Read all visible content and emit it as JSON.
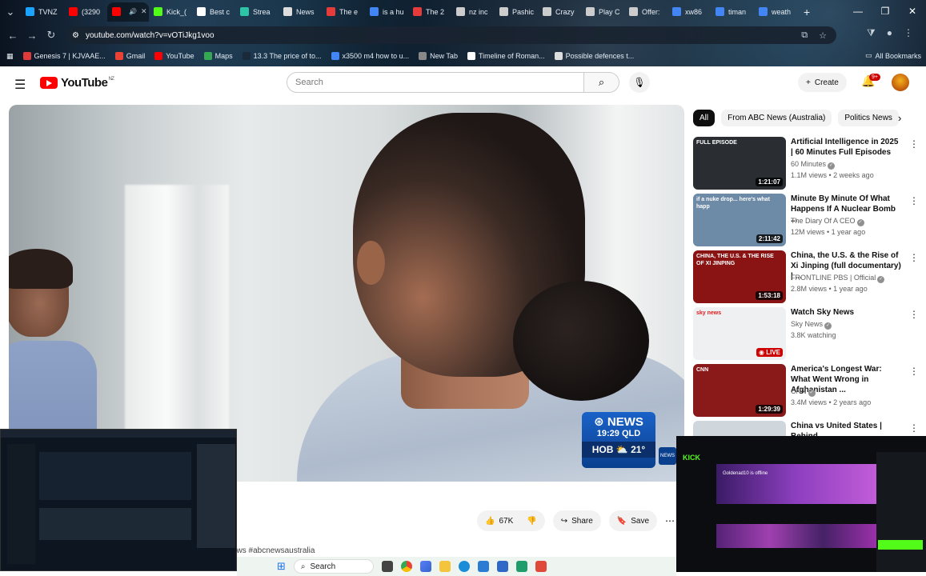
{
  "browser": {
    "tabs": [
      {
        "label": "TVNZ",
        "color": "#1aa3ff"
      },
      {
        "label": "(3290",
        "color": "#ff0000"
      },
      {
        "label": "",
        "color": "#ff0000",
        "active": true
      },
      {
        "label": "Kick_(",
        "color": "#53fc18"
      },
      {
        "label": "Best c",
        "color": "#ffffff"
      },
      {
        "label": "Strea",
        "color": "#2ec4a6"
      },
      {
        "label": "News",
        "color": "#dddddd"
      },
      {
        "label": "The e",
        "color": "#e63b3b"
      },
      {
        "label": "is a hu",
        "color": "#4285f4"
      },
      {
        "label": "The 2",
        "color": "#e63b3b"
      },
      {
        "label": "nz inc",
        "color": "#cccccc"
      },
      {
        "label": "Pashic",
        "color": "#cccccc"
      },
      {
        "label": "Crazy",
        "color": "#cccccc"
      },
      {
        "label": "Play C",
        "color": "#cccccc"
      },
      {
        "label": "Offer:",
        "color": "#cccccc"
      },
      {
        "label": "xw86",
        "color": "#4285f4"
      },
      {
        "label": "timan",
        "color": "#4285f4"
      },
      {
        "label": "weath",
        "color": "#4285f4"
      }
    ],
    "url": "youtube.com/watch?v=vOTiJkg1voo",
    "bookmarks": [
      {
        "label": "Genesis 7 | KJVAAE...",
        "color": "#e03a3a"
      },
      {
        "label": "Gmail",
        "color": "#ea4335"
      },
      {
        "label": "YouTube",
        "color": "#ff0000"
      },
      {
        "label": "Maps",
        "color": "#34a853"
      },
      {
        "label": "13.3 The price of to...",
        "color": "#1a2a3a"
      },
      {
        "label": "x3500 m4 how to u...",
        "color": "#4285f4"
      },
      {
        "label": "New Tab",
        "color": "#888888"
      },
      {
        "label": "Timeline of Roman...",
        "color": "#ffffff"
      },
      {
        "label": "Possible defences t...",
        "color": "#dddddd"
      }
    ],
    "all_bookmarks": "All Bookmarks"
  },
  "youtube": {
    "region": "NZ",
    "logo_text": "YouTube",
    "search_placeholder": "Search",
    "create_label": "Create",
    "notif_count": "9+",
    "chips": [
      "All",
      "From ABC News (Australia)",
      "Politics News"
    ],
    "actions": {
      "likes": "67K",
      "share": "Share",
      "save": "Save"
    },
    "hashtags": "ews #abcnewsaustralia",
    "overlay": {
      "brand": "NEWS",
      "time": "19:29",
      "tz": "QLD",
      "city": "HOB",
      "temp": "21°",
      "mark": "NEWS"
    },
    "related": [
      {
        "title": "Artificial Intelligence in 2025 | 60 Minutes Full Episodes",
        "channel": "60 Minutes",
        "verified": true,
        "meta": "1.1M views • 2 weeks ago",
        "duration": "1:21:07",
        "label": "FULL EPISODE",
        "thumb_color": "#2a2e33"
      },
      {
        "title": "Minute By Minute Of What Happens If A Nuclear Bomb ...",
        "channel": "The Diary Of A CEO",
        "verified": true,
        "meta": "12M views • 1 year ago",
        "duration": "2:11:42",
        "label": "if a nuke drop... here's what happ",
        "thumb_color": "#6d8aa6"
      },
      {
        "title": "China, the U.S. & the Rise of Xi Jinping (full documentary) | ...",
        "channel": "FRONTLINE PBS | Official",
        "verified": true,
        "meta": "2.8M views • 1 year ago",
        "duration": "1:53:18",
        "label": "CHINA, THE U.S. & THE RISE OF XI JINPING",
        "thumb_color": "#8a1414"
      },
      {
        "title": "Watch Sky News",
        "channel": "Sky News",
        "verified": true,
        "meta": "3.8K watching",
        "duration": "LIVE",
        "label": "sky news",
        "thumb_color": "#eef0f2"
      },
      {
        "title": "America's Longest War: What Went Wrong in Afghanistan ...",
        "channel": "CNN",
        "verified": true,
        "meta": "3.4M views • 2 years ago",
        "duration": "1:29:39",
        "label": "CNN",
        "thumb_color": "#8a1a1a"
      },
      {
        "title": "China vs United States | Behind",
        "channel": "",
        "verified": false,
        "meta": "",
        "duration": "",
        "label": "",
        "thumb_color": "#cfd6dc"
      }
    ]
  },
  "taskbar": {
    "search": "Search"
  },
  "kick_overlay": {
    "brand": "KICK",
    "status": "Goldenad10 is offline"
  }
}
